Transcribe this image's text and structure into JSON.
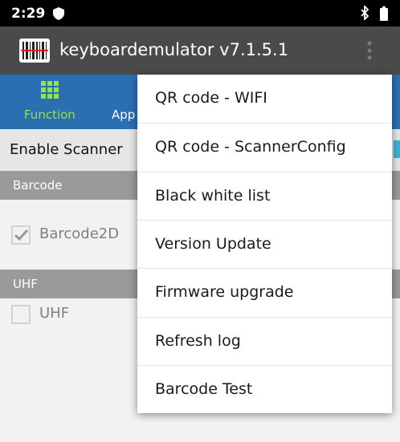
{
  "status_bar": {
    "time": "2:29",
    "icons": [
      "shield-icon",
      "bluetooth-icon",
      "battery-icon"
    ]
  },
  "app_bar": {
    "title": "keyboardemulator v7.1.5.1",
    "logo_icon": "barcode-logo-icon",
    "overflow_icon": "more-vert-icon"
  },
  "tabs": {
    "function_label": "Function",
    "app_label_partial": "App",
    "function_icon": "grid-icon",
    "active_color": "#8fe34f"
  },
  "settings": {
    "enable_scanner_label": "Enable Scanner",
    "barcode_header": "Barcode",
    "barcode2d_label": "Barcode2D",
    "barcode2d_checked": true,
    "uhf_header": "UHF",
    "uhf_label": "UHF",
    "uhf_checked": false
  },
  "menu": {
    "items": [
      "QR code - WIFI",
      "QR code - ScannerConfig",
      "Black white list",
      "Version Update",
      "Firmware upgrade",
      "Refresh log",
      "Barcode Test"
    ]
  },
  "colors": {
    "status_bar": "#000000",
    "app_bar": "#4a4a4a",
    "tab_bar": "#2b6fb3",
    "section_header": "#9a9a9a",
    "accent": "#39b4d6"
  }
}
